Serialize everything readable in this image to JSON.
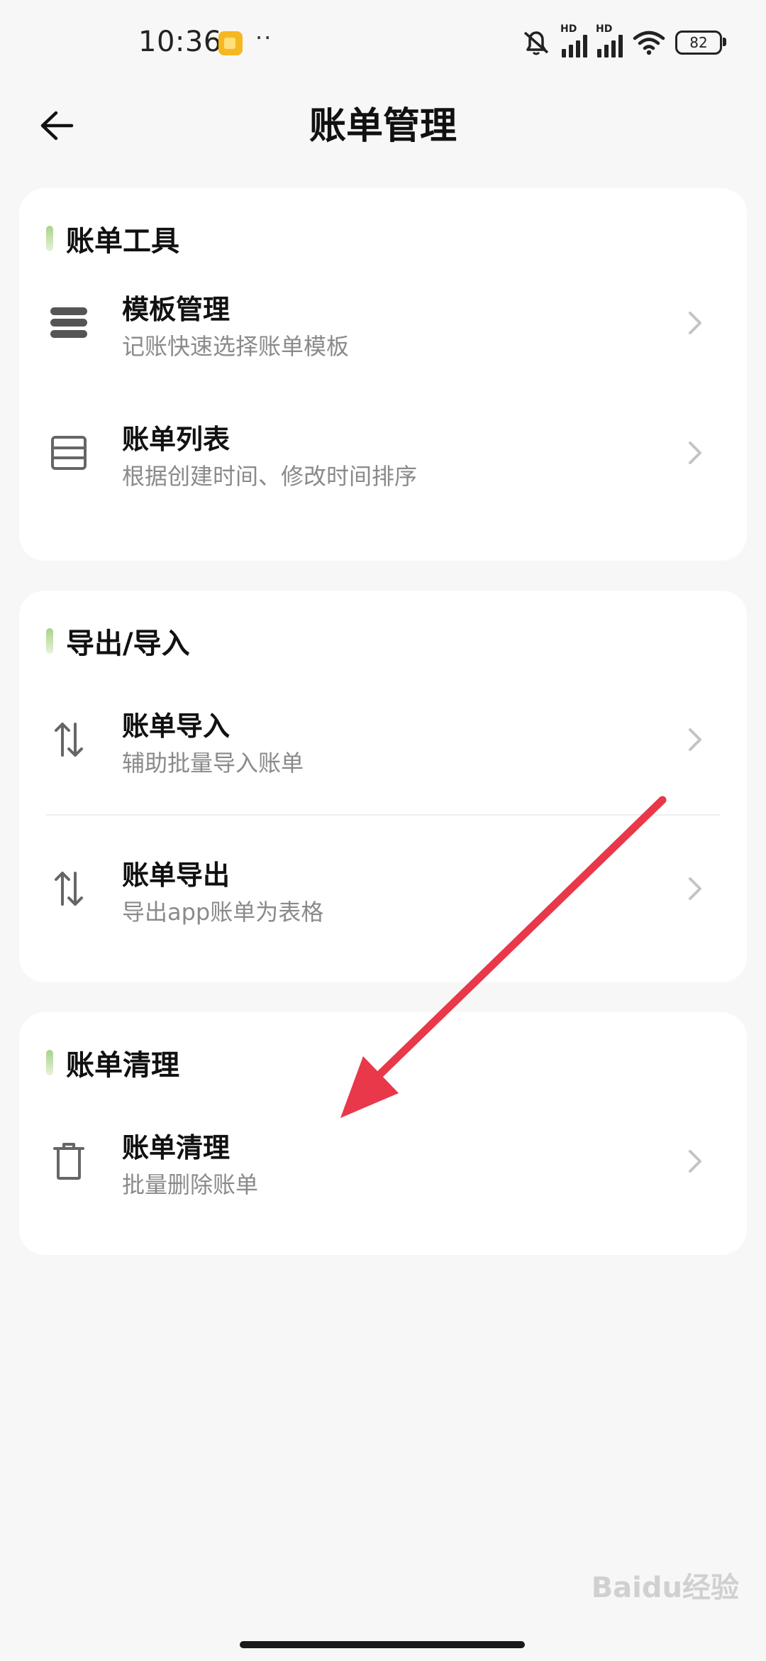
{
  "status_bar": {
    "time": "10:36",
    "dots": "··",
    "hd_1": "HD",
    "hd_2": "HD",
    "battery": "82"
  },
  "header": {
    "title": "账单管理"
  },
  "sections": {
    "tools": {
      "title": "账单工具",
      "items": [
        {
          "title": "模板管理",
          "subtitle": "记账快速选择账单模板",
          "icon": "stack-icon"
        },
        {
          "title": "账单列表",
          "subtitle": "根据创建时间、修改时间排序",
          "icon": "list-icon"
        }
      ]
    },
    "export_import": {
      "title": "导出/导入",
      "items": [
        {
          "title": "账单导入",
          "subtitle": "辅助批量导入账单",
          "icon": "swap-vertical-icon"
        },
        {
          "title": "账单导出",
          "subtitle": "导出app账单为表格",
          "icon": "swap-vertical-icon"
        }
      ]
    },
    "cleanup": {
      "title": "账单清理",
      "items": [
        {
          "title": "账单清理",
          "subtitle": "批量删除账单",
          "icon": "trash-icon"
        }
      ]
    }
  },
  "annotation": {
    "arrow_color": "#e8384a"
  },
  "watermark": "Baidu经验"
}
